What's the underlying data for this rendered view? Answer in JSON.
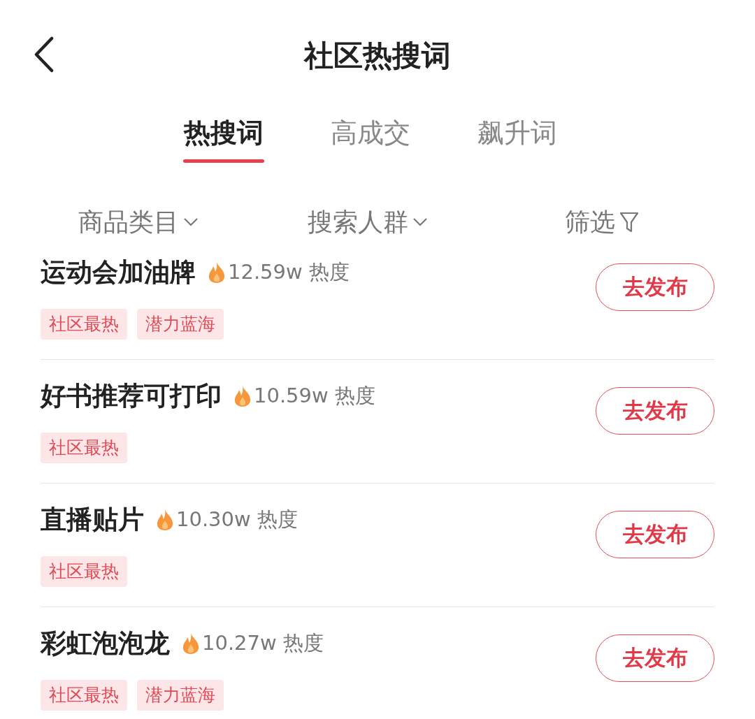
{
  "header": {
    "title": "社区热搜词"
  },
  "tabs": [
    {
      "label": "热搜词",
      "selected": true
    },
    {
      "label": "高成交",
      "selected": false
    },
    {
      "label": "飙升词",
      "selected": false
    }
  ],
  "filters": [
    {
      "label": "商品类目",
      "kind": "dropdown"
    },
    {
      "label": "搜索人群",
      "kind": "dropdown"
    },
    {
      "label": "筛选",
      "kind": "filter"
    }
  ],
  "items": [
    {
      "keyword": "运动会加油牌",
      "heat": "12.59w 热度",
      "tags": [
        "社区最热",
        "潜力蓝海"
      ],
      "button": "去发布"
    },
    {
      "keyword": "好书推荐可打印",
      "heat": "10.59w 热度",
      "tags": [
        "社区最热"
      ],
      "button": "去发布"
    },
    {
      "keyword": "直播贴片",
      "heat": "10.30w 热度",
      "tags": [
        "社区最热"
      ],
      "button": "去发布"
    },
    {
      "keyword": "彩虹泡泡龙",
      "heat": "10.27w 热度",
      "tags": [
        "社区最热",
        "潜力蓝海"
      ],
      "button": "去发布"
    }
  ]
}
